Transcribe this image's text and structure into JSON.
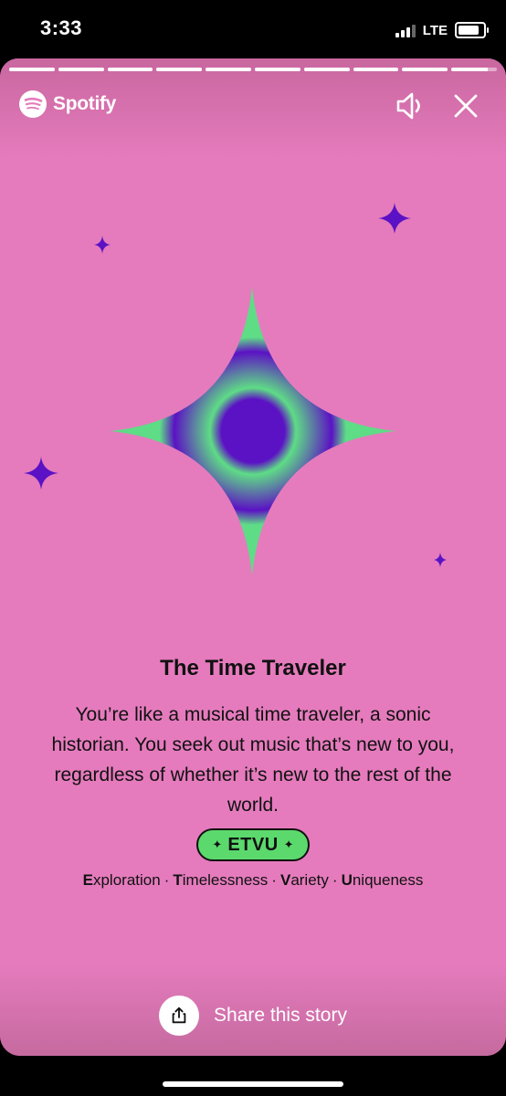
{
  "status_bar": {
    "time": "3:33",
    "network": "LTE",
    "battery_level": 0.85
  },
  "story": {
    "progress_total": 10,
    "progress_current": 10,
    "current_progress_fraction": 0.8,
    "brand": "Spotify",
    "sound_icon": "speaker-icon",
    "close_icon": "close-icon",
    "colors": {
      "background": "#e57bbd",
      "accent_purple": "#5b12c4",
      "accent_green": "#5bd96d"
    },
    "title": "The Time Traveler",
    "description": "You’re like a musical time traveler, a sonic historian. You seek out music that’s new to you, regardless of whether it’s new to the rest of the world.",
    "badge": "ETVU",
    "traits": [
      {
        "initial": "E",
        "rest": "xploration"
      },
      {
        "initial": "T",
        "rest": "imelessness"
      },
      {
        "initial": "V",
        "rest": "ariety"
      },
      {
        "initial": "U",
        "rest": "niqueness"
      }
    ],
    "share_label": "Share this story",
    "share_icon": "share-icon"
  }
}
